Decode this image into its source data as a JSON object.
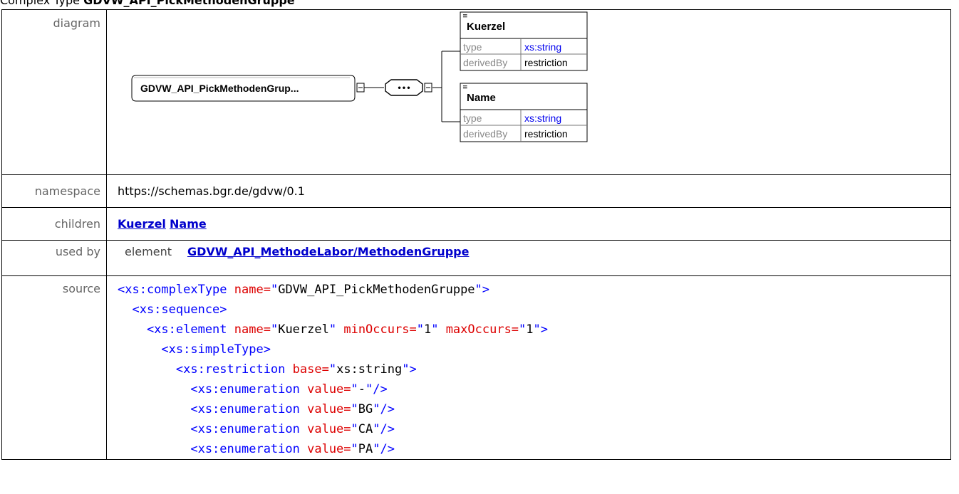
{
  "header": {
    "prefix": "Complex Type ",
    "name_visible": "GDVW_API_PickMethodenGruppe"
  },
  "rows": {
    "diagram_label": "diagram",
    "namespace_label": "namespace",
    "namespace_value": "https://schemas.bgr.de/gdvw/0.1",
    "children_label": "children",
    "children": [
      "Kuerzel",
      "Name"
    ],
    "usedby_label": "used by",
    "usedby_kind": "element",
    "usedby_link": "GDVW_API_MethodeLabor/MethodenGruppe",
    "source_label": "source"
  },
  "diagram": {
    "root_label": "GDVW_API_PickMethodenGrup...",
    "sequence_symbol": "•••",
    "elements": [
      {
        "name": "Kuerzel",
        "props": [
          {
            "key": "type",
            "value": "xs:string"
          },
          {
            "key": "derivedBy",
            "value": "restriction"
          }
        ]
      },
      {
        "name": "Name",
        "props": [
          {
            "key": "type",
            "value": "xs:string"
          },
          {
            "key": "derivedBy",
            "value": "restriction"
          }
        ]
      }
    ]
  },
  "source": {
    "lines": [
      [
        [
          "tag",
          "<xs:complexType "
        ],
        [
          "att",
          "name="
        ],
        [
          "tag",
          "\""
        ],
        [
          "val",
          "GDVW_API_PickMethodenGruppe"
        ],
        [
          "tag",
          "\">"
        ]
      ],
      [
        [
          "tag",
          "  <xs:sequence>"
        ]
      ],
      [
        [
          "tag",
          "    <xs:element "
        ],
        [
          "att",
          "name="
        ],
        [
          "tag",
          "\""
        ],
        [
          "val",
          "Kuerzel"
        ],
        [
          "tag",
          "\" "
        ],
        [
          "att",
          "minOccurs="
        ],
        [
          "tag",
          "\""
        ],
        [
          "val",
          "1"
        ],
        [
          "tag",
          "\" "
        ],
        [
          "att",
          "maxOccurs="
        ],
        [
          "tag",
          "\""
        ],
        [
          "val",
          "1"
        ],
        [
          "tag",
          "\">"
        ]
      ],
      [
        [
          "tag",
          "      <xs:simpleType>"
        ]
      ],
      [
        [
          "tag",
          "        <xs:restriction "
        ],
        [
          "att",
          "base="
        ],
        [
          "tag",
          "\""
        ],
        [
          "val",
          "xs:string"
        ],
        [
          "tag",
          "\">"
        ]
      ],
      [
        [
          "tag",
          "          <xs:enumeration "
        ],
        [
          "att",
          "value="
        ],
        [
          "tag",
          "\""
        ],
        [
          "val",
          "-"
        ],
        [
          "tag",
          "\"/>"
        ]
      ],
      [
        [
          "tag",
          "          <xs:enumeration "
        ],
        [
          "att",
          "value="
        ],
        [
          "tag",
          "\""
        ],
        [
          "val",
          "BG"
        ],
        [
          "tag",
          "\"/>"
        ]
      ],
      [
        [
          "tag",
          "          <xs:enumeration "
        ],
        [
          "att",
          "value="
        ],
        [
          "tag",
          "\""
        ],
        [
          "val",
          "CA"
        ],
        [
          "tag",
          "\"/>"
        ]
      ],
      [
        [
          "tag",
          "          <xs:enumeration "
        ],
        [
          "att",
          "value="
        ],
        [
          "tag",
          "\""
        ],
        [
          "val",
          "PA"
        ],
        [
          "tag",
          "\"/>"
        ]
      ]
    ]
  }
}
